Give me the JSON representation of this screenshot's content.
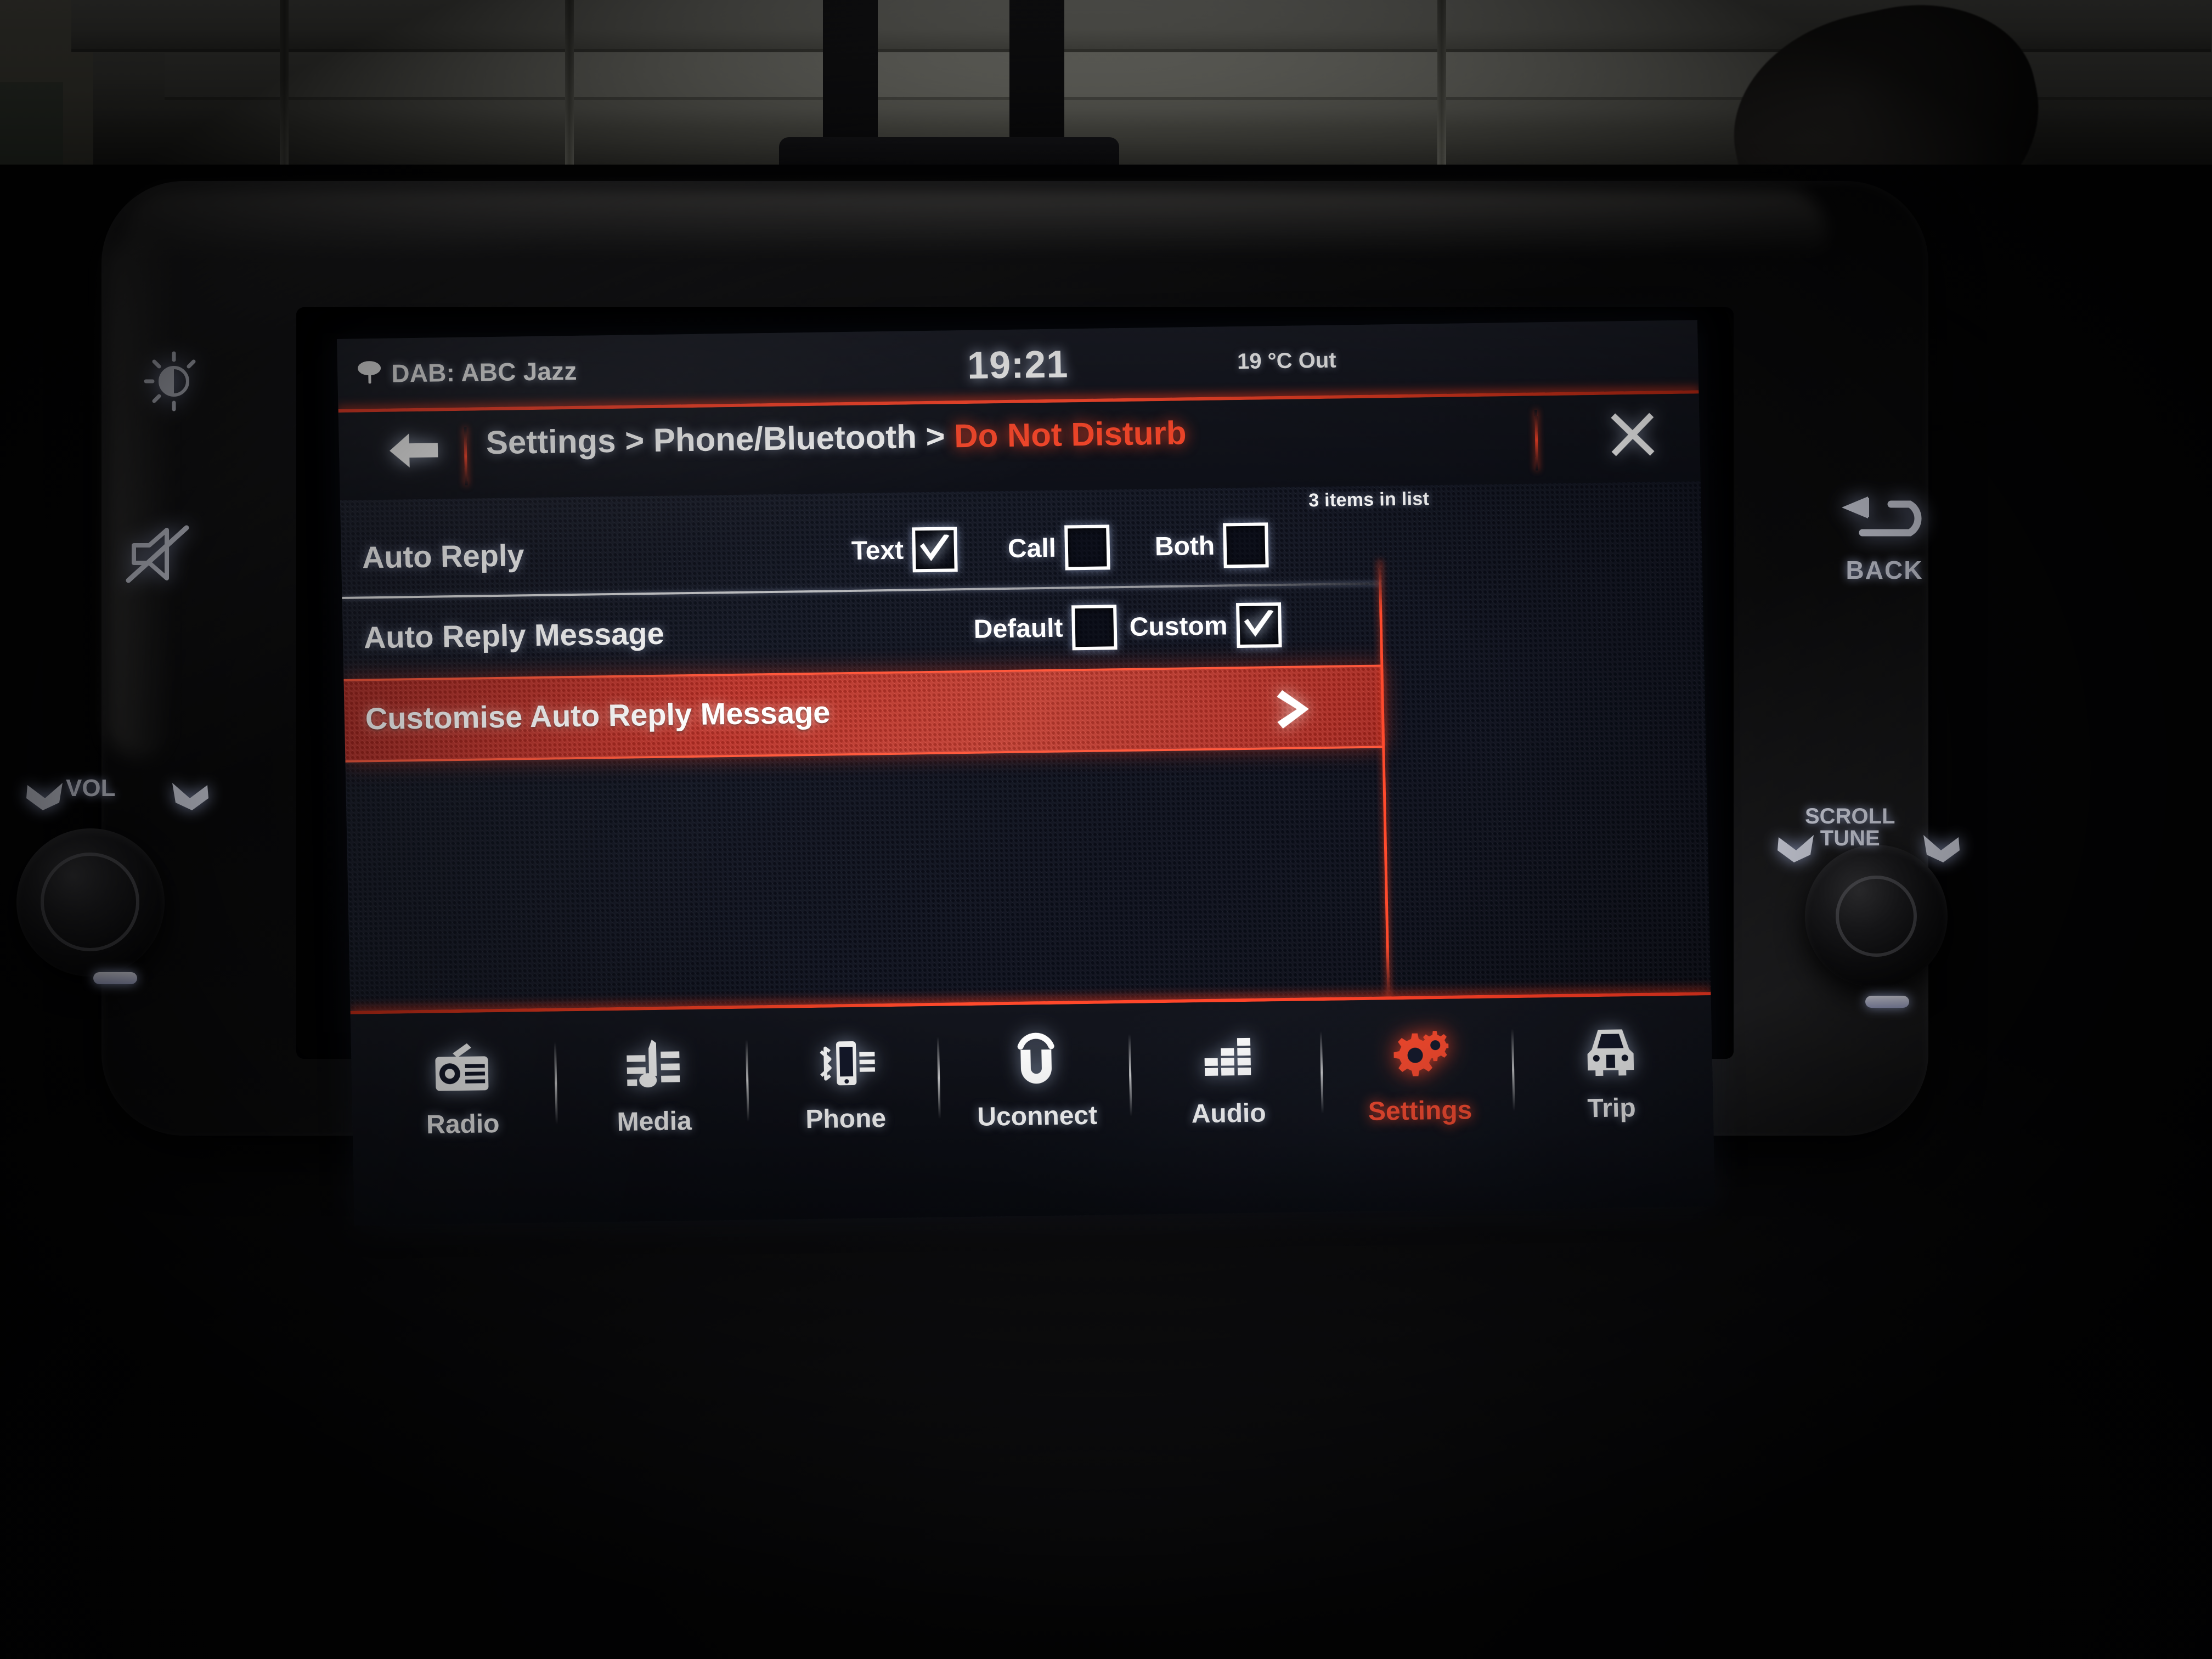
{
  "status_bar": {
    "source_icon": "broadcast-antenna-icon",
    "source": "DAB: ABC Jazz",
    "clock": "19:21",
    "temperature": "19 °C Out"
  },
  "header": {
    "back_icon": "back-arrow-icon",
    "breadcrumb_root": "Settings",
    "breadcrumb_sep1": ">",
    "breadcrumb_parent": "Phone/Bluetooth",
    "breadcrumb_sep2": ">",
    "breadcrumb_current": "Do Not Disturb",
    "close_icon": "close-x-icon",
    "items_count": "3 items in list"
  },
  "list": {
    "rows": [
      {
        "label": "Auto Reply",
        "options": [
          {
            "label": "Text",
            "checked": true
          },
          {
            "label": "Call",
            "checked": false
          },
          {
            "label": "Both",
            "checked": false
          }
        ]
      },
      {
        "label": "Auto Reply Message",
        "options": [
          {
            "label": "Default",
            "checked": false
          },
          {
            "label": "Custom",
            "checked": true
          }
        ]
      },
      {
        "label": "Customise Auto Reply Message",
        "highlighted": true,
        "chevron": "chevron-right-icon"
      }
    ]
  },
  "nav": {
    "items": [
      {
        "label": "Radio",
        "icon": "radio-icon",
        "active": false
      },
      {
        "label": "Media",
        "icon": "media-note-icon",
        "active": false
      },
      {
        "label": "Phone",
        "icon": "phone-bluetooth-icon",
        "active": false
      },
      {
        "label": "Uconnect",
        "icon": "uconnect-icon",
        "active": false
      },
      {
        "label": "Audio",
        "icon": "equalizer-icon",
        "active": false
      },
      {
        "label": "Settings",
        "icon": "gears-icon",
        "active": true
      },
      {
        "label": "Trip",
        "icon": "car-icon",
        "active": false
      }
    ]
  },
  "hardware": {
    "brightness_icon": "brightness-sun-icon",
    "mute_icon": "mute-speaker-icon",
    "back_label": "BACK",
    "back_icon": "u-turn-arrow-icon",
    "vol_label": "VOL",
    "scroll_label": "SCROLL",
    "tune_label": "TUNE",
    "power_icon": "power-icon"
  },
  "colors": {
    "accent_red": "#ff4a2c",
    "highlight_red": "#cf3328",
    "screen_bg": "#121624",
    "text": "#ffffff"
  }
}
